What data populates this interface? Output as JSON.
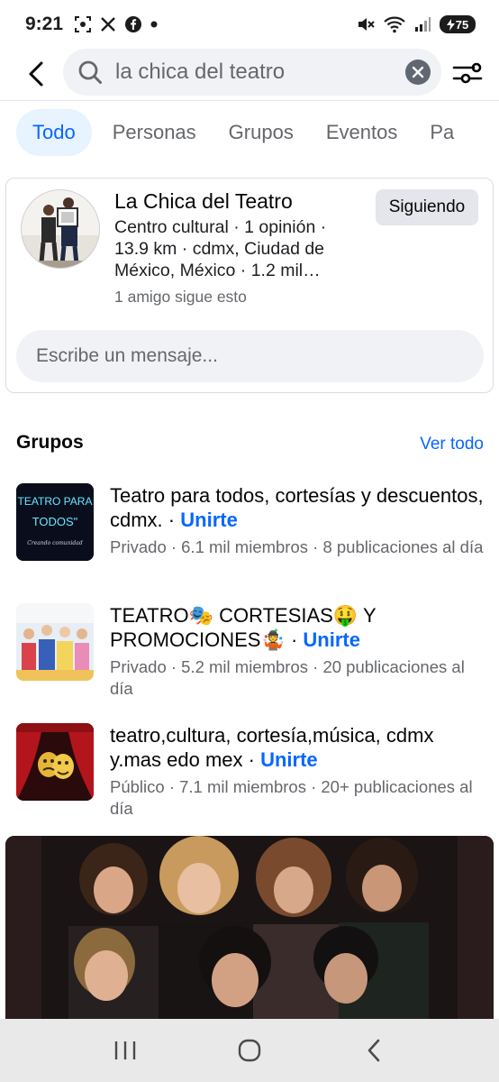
{
  "status": {
    "time": "9:21",
    "battery": "75"
  },
  "search": {
    "query": "la chica del teatro"
  },
  "tabs": [
    {
      "label": "Todo"
    },
    {
      "label": "Personas"
    },
    {
      "label": "Grupos"
    },
    {
      "label": "Eventos"
    },
    {
      "label": "Pa"
    }
  ],
  "page_result": {
    "name": "La Chica del Teatro",
    "meta": "Centro cultural · 1 opinión · 13.9 km · cdmx, Ciudad de México, México · 1.2 mil…",
    "friends": "1 amigo sigue esto",
    "follow_label": "Siguiendo",
    "message_placeholder": "Escribe un mensaje..."
  },
  "groups_section": {
    "title": "Grupos",
    "see_all": "Ver todo",
    "items": [
      {
        "name": "Teatro para todos, cortesías y descuentos, cdmx.",
        "join": "Unirte",
        "meta": "Privado · 6.1 mil miembros · 8 publicaciones al día",
        "thumb_text_1": "TEATRO PARA",
        "thumb_text_2": "TODOS\"",
        "thumb_text_3": "Creando comunidad"
      },
      {
        "name": "TEATRO🎭 CORTESIAS🤑 Y PROMOCIONES🤹",
        "join": "Unirte",
        "meta": "Privado · 5.2 mil miembros · 20 publicaciones al día"
      },
      {
        "name": "teatro,cultura, cortesía,música, cdmx y.mas edo mex",
        "join": "Unirte",
        "meta": "Público · 7.1 mil miembros · 20+ publicaciones al día"
      }
    ]
  },
  "colors": {
    "accent": "#0866ff",
    "secondary_text": "#65676b",
    "surface": "#f0f2f5"
  },
  "icons": {
    "back": "arrow-left-icon",
    "search": "search-icon",
    "clear": "clear-icon",
    "filter": "sliders-icon",
    "nav_recent": "recent-apps-icon",
    "nav_home": "home-icon",
    "nav_back": "back-icon"
  }
}
